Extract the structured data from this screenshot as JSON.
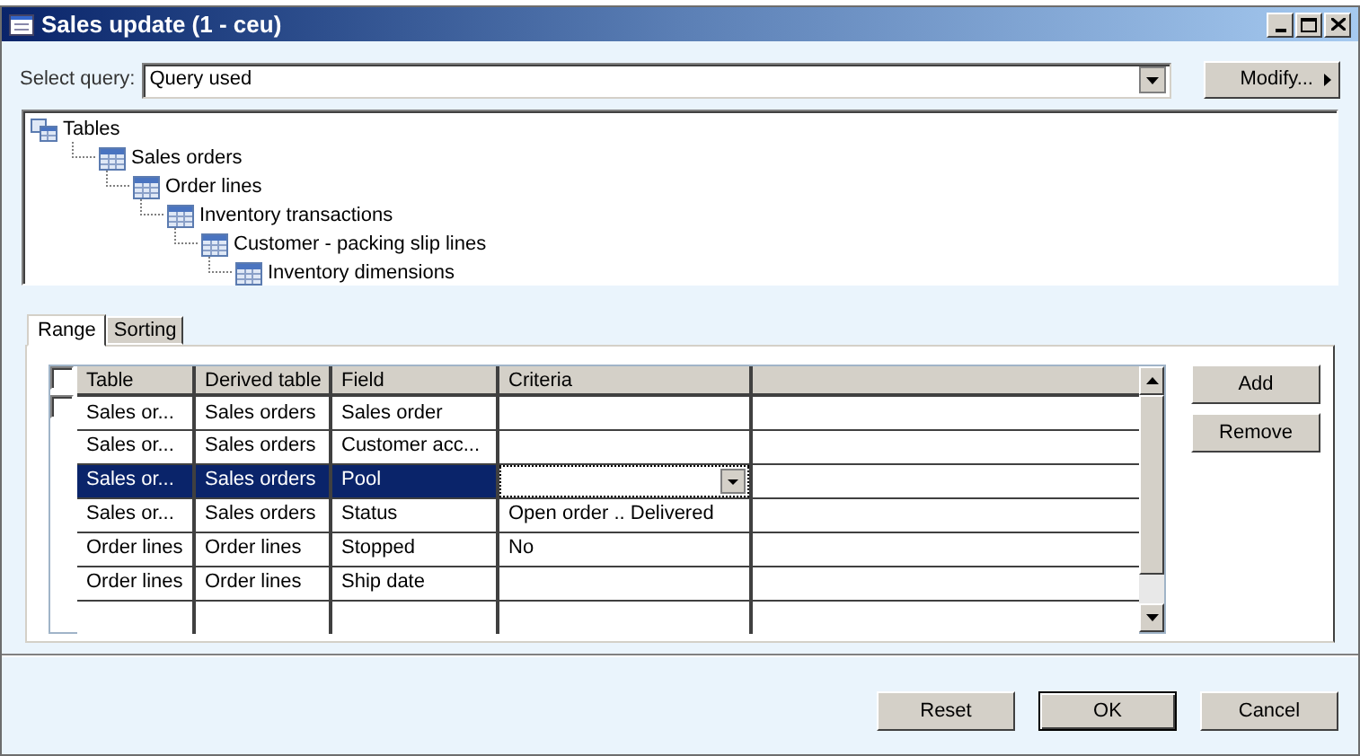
{
  "window": {
    "title": "Sales update (1 - ceu)"
  },
  "query": {
    "label": "Select query:",
    "value": "Query used",
    "modify_button": "Modify..."
  },
  "tree": [
    {
      "label": "Tables",
      "kind": "root",
      "children": [
        {
          "label": "Sales orders",
          "kind": "table",
          "children": [
            {
              "label": "Order lines",
              "kind": "table",
              "children": [
                {
                  "label": "Inventory transactions",
                  "kind": "table",
                  "children": [
                    {
                      "label": "Customer - packing slip lines",
                      "kind": "table",
                      "children": [
                        {
                          "label": "Inventory dimensions",
                          "kind": "table"
                        }
                      ]
                    }
                  ]
                }
              ]
            }
          ]
        }
      ]
    }
  ],
  "tabs": [
    {
      "label": "Range",
      "selected": true
    },
    {
      "label": "Sorting",
      "selected": false
    }
  ],
  "grid": {
    "header_checked": false,
    "columns": [
      "Table",
      "Derived table",
      "Field",
      "Criteria"
    ],
    "rows": [
      {
        "checked": false,
        "selected": false,
        "cells": [
          "Sales or...",
          "Sales orders",
          "Sales order",
          ""
        ]
      },
      {
        "selected": false,
        "cells": [
          "Sales or...",
          "Sales orders",
          "Customer acc...",
          ""
        ]
      },
      {
        "selected": true,
        "cells": [
          "Sales or...",
          "Sales orders",
          "Pool",
          ""
        ]
      },
      {
        "selected": false,
        "cells": [
          "Sales or...",
          "Sales orders",
          "Status",
          "Open order .. Delivered"
        ]
      },
      {
        "selected": false,
        "cells": [
          "Order lines",
          "Order lines",
          "Stopped",
          "No"
        ]
      },
      {
        "selected": false,
        "cells": [
          "Order lines",
          "Order lines",
          "Ship date",
          ""
        ]
      }
    ]
  },
  "side_buttons": [
    "Add",
    "Remove"
  ],
  "footer_buttons": [
    {
      "label": "Reset",
      "default": false
    },
    {
      "label": "OK",
      "default": true
    },
    {
      "label": "Cancel",
      "default": false
    }
  ]
}
